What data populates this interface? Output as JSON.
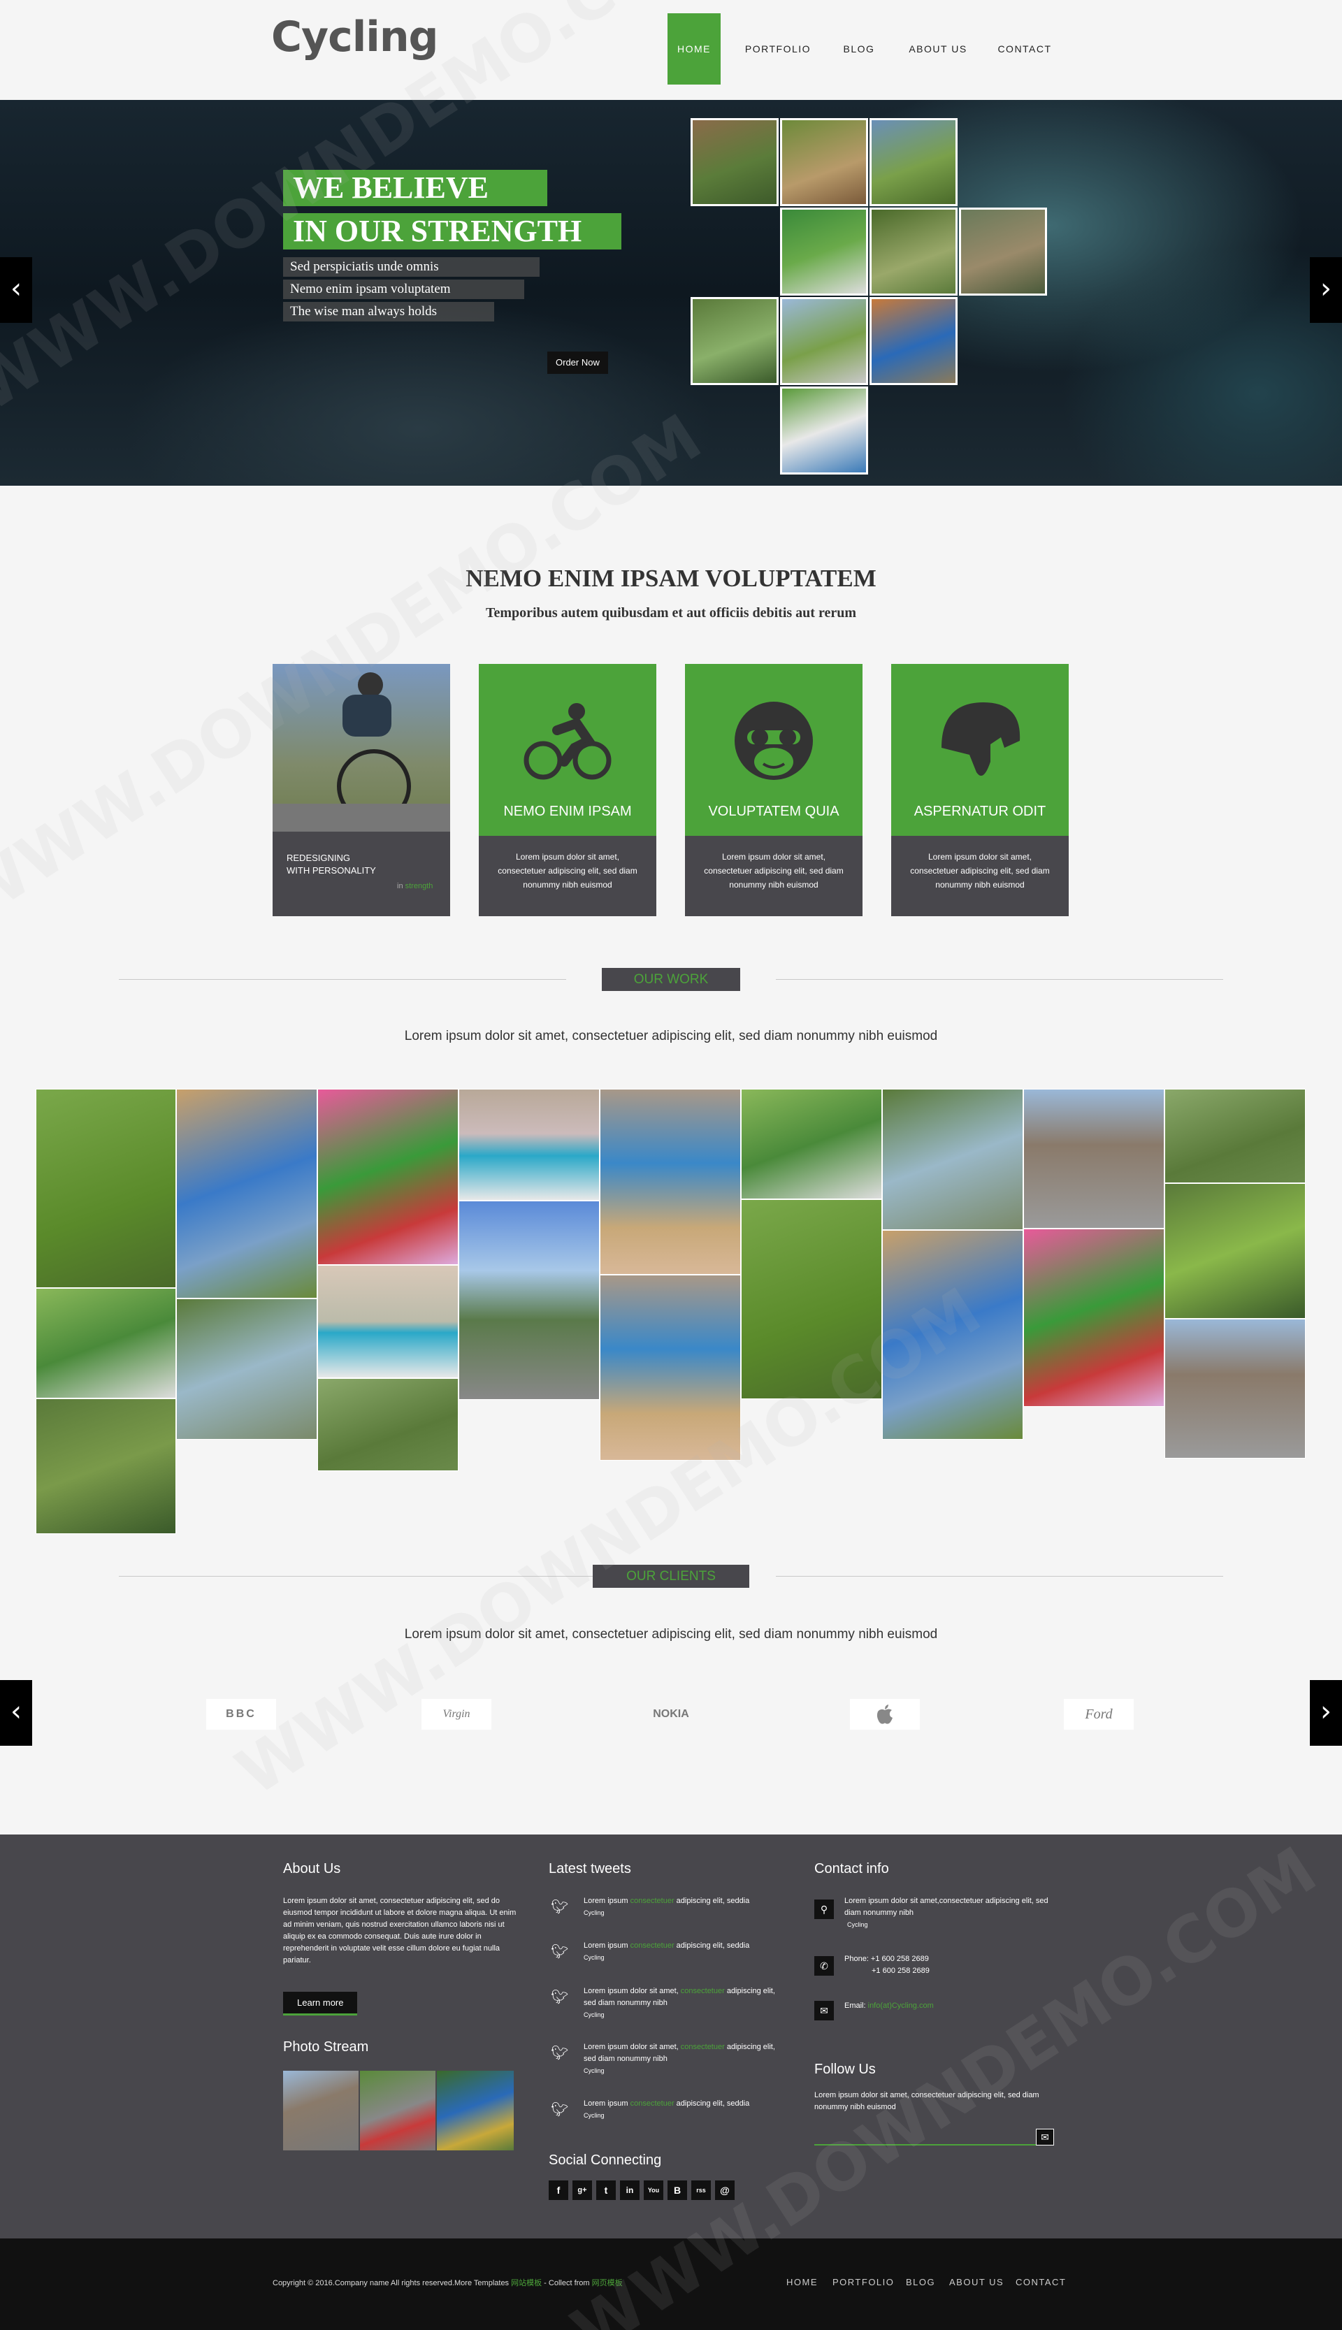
{
  "header": {
    "logo": "Cycling",
    "nav": [
      "HOME",
      "PORTFOLIO",
      "BLOG",
      "ABOUT US",
      "CONTACT"
    ],
    "active": "HOME"
  },
  "hero": {
    "headline_1": "WE BELIEVE",
    "headline_2": "IN OUR STRENGTH",
    "lines": [
      "Sed perspiciatis unde omnis",
      "Nemo enim ipsam voluptatem",
      "The wise man always holds"
    ],
    "button": "Order Now",
    "slides": 5,
    "active_slide": 1
  },
  "intro": {
    "title": "NEMO ENIM IPSAM VOLUPTATEM",
    "subtitle": "Temporibus autem quibusdam et aut officiis debitis aut rerum"
  },
  "cards": {
    "photo_card": {
      "line1": "REDESIGNING",
      "line2": "WITH PERSONALITY",
      "tag_prefix": "in",
      "tag": "strength"
    },
    "items": [
      {
        "title": "NEMO ENIM IPSAM",
        "text": "Lorem ipsum dolor sit amet, consectetuer adipiscing elit, sed diam nonummy nibh euismod",
        "icon": "cyclist-icon"
      },
      {
        "title": "VOLUPTATEM QUIA",
        "text": "Lorem ipsum dolor sit amet, consectetuer adipiscing elit, sed diam nonummy nibh euismod",
        "icon": "helmet-face-icon"
      },
      {
        "title": "ASPERNATUR ODIT",
        "text": "Lorem ipsum dolor sit amet, consectetuer adipiscing elit, sed diam nonummy nibh euismod",
        "icon": "helmet-icon"
      }
    ]
  },
  "work": {
    "label": "OUR WORK",
    "lead": "Lorem ipsum dolor sit amet, consectetuer adipiscing elit, sed diam nonummy nibh euismod"
  },
  "clients": {
    "label": "OUR CLIENTS",
    "lead": "Lorem ipsum dolor sit amet, consectetuer adipiscing elit, sed diam nonummy nibh euismod",
    "logos": [
      "BBC",
      "Virgin",
      "NOKIA",
      "",
      "Ford"
    ]
  },
  "footer": {
    "about": {
      "title": "About Us",
      "text": "Lorem ipsum dolor sit amet, consectetuer adipiscing elit, sed do eiusmod tempor incididunt ut labore et dolore magna aliqua. Ut enim ad minim veniam, quis nostrud exercitation ullamco laboris nisi ut aliquip ex ea commodo consequat. Duis aute irure dolor in reprehenderit in voluptate velit esse cillum dolore eu fugiat nulla pariatur.",
      "button": "Learn more"
    },
    "photo_stream": {
      "title": "Photo Stream"
    },
    "tweets": {
      "title": "Latest tweets",
      "items": [
        {
          "pre": "Lorem ipsum ",
          "link": "consectetuer",
          "post": " adipiscing elit, seddia",
          "meta": "Cycling"
        },
        {
          "pre": "Lorem ipsum ",
          "link": "consectetuer",
          "post": " adipiscing elit, seddia",
          "meta": "Cycling"
        },
        {
          "pre": "Lorem ipsum dolor sit amet, ",
          "link": "consectetuer",
          "post": " adipiscing elit, sed diam nonummy nibh",
          "meta": "Cycling"
        },
        {
          "pre": "Lorem ipsum dolor sit amet, ",
          "link": "consectetuer",
          "post": " adipiscing elit, sed diam nonummy nibh",
          "meta": "Cycling"
        },
        {
          "pre": "Lorem ipsum ",
          "link": "consectetuer",
          "post": " adipiscing elit, seddia",
          "meta": "Cycling"
        }
      ]
    },
    "social": {
      "title": "Social Connecting",
      "icons": [
        "f",
        "g+",
        "t",
        "in",
        "You",
        "B",
        "rss",
        "@"
      ]
    },
    "contact": {
      "title": "Contact info",
      "address": "Lorem ipsum dolor sit amet,consectetuer adipiscing elit, sed diam nonummy nibh",
      "address_meta": "Cycling",
      "phone_label": "Phone: +1 600 258 2689",
      "phone_2": "+1 600 258 2689",
      "email_label": "Email: ",
      "email": "info(at)Cycling.com"
    },
    "follow": {
      "title": "Follow Us",
      "text": "Lorem ipsum dolor sit amet, consectetuer adipiscing elit, sed diam nonummy nibh euismod"
    }
  },
  "copyright": {
    "text": "Copyright © 2016.Company name All rights reserved.More Templates ",
    "link1": "网站模板",
    "middle": " - Collect from ",
    "link2": "网页模板",
    "nav": [
      "HOME",
      "PORTFOLIO",
      "BLOG",
      "ABOUT US",
      "CONTACT"
    ]
  },
  "watermark": "WWW.DOWNDEMO.COM",
  "colors": {
    "accent": "#4ca33a",
    "dark": "#48474c",
    "bg": "#f5f5f5"
  }
}
